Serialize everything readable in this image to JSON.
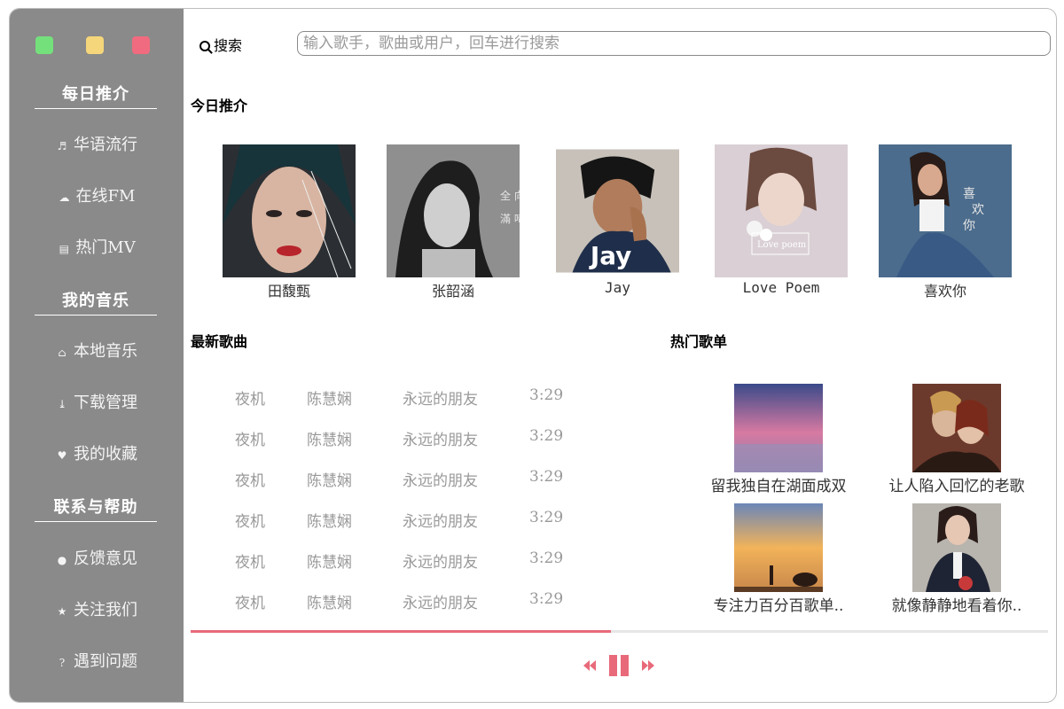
{
  "window_controls": [
    "close",
    "minimize",
    "maximize"
  ],
  "colors": {
    "sidebar": "#8a8a8a",
    "accent": "#e86a7a",
    "muted_text": "#999999"
  },
  "sidebar": {
    "sections": [
      {
        "title": "每日推介",
        "items": [
          {
            "icon": "music-note-icon",
            "label": "华语流行"
          },
          {
            "icon": "cloud-icon",
            "label": "在线FM"
          },
          {
            "icon": "film-icon",
            "label": "热门MV"
          }
        ]
      },
      {
        "title": "我的音乐",
        "items": [
          {
            "icon": "home-icon",
            "label": "本地音乐"
          },
          {
            "icon": "download-icon",
            "label": "下载管理"
          },
          {
            "icon": "heart-icon",
            "label": "我的收藏"
          }
        ]
      },
      {
        "title": "联系与帮助",
        "items": [
          {
            "icon": "comment-icon",
            "label": "反馈意见"
          },
          {
            "icon": "star-icon",
            "label": "关注我们"
          },
          {
            "icon": "question-icon",
            "label": "遇到问题"
          }
        ]
      }
    ]
  },
  "search": {
    "label": "搜索",
    "placeholder": "输入歌手，歌曲或用户，回车进行搜索",
    "value": ""
  },
  "today": {
    "title": "今日推介",
    "albums": [
      {
        "name": "田馥甄"
      },
      {
        "name": "张韶涵"
      },
      {
        "name": "Jay"
      },
      {
        "name": "Love Poem"
      },
      {
        "name": "喜欢你"
      }
    ]
  },
  "newest": {
    "title": "最新歌曲",
    "songs": [
      {
        "title": "夜机",
        "artist": "陈慧娴",
        "album": "永远的朋友",
        "duration": "3:29"
      },
      {
        "title": "夜机",
        "artist": "陈慧娴",
        "album": "永远的朋友",
        "duration": "3:29"
      },
      {
        "title": "夜机",
        "artist": "陈慧娴",
        "album": "永远的朋友",
        "duration": "3:29"
      },
      {
        "title": "夜机",
        "artist": "陈慧娴",
        "album": "永远的朋友",
        "duration": "3:29"
      },
      {
        "title": "夜机",
        "artist": "陈慧娴",
        "album": "永远的朋友",
        "duration": "3:29"
      },
      {
        "title": "夜机",
        "artist": "陈慧娴",
        "album": "永远的朋友",
        "duration": "3:29"
      }
    ]
  },
  "hot": {
    "title": "热门歌单",
    "playlists": [
      {
        "name": "留我独自在湖面成双"
      },
      {
        "name": "让人陷入回忆的老歌"
      },
      {
        "name": "专注力百分百歌单.."
      },
      {
        "name": "就像静静地看着你.."
      }
    ]
  },
  "player": {
    "progress": 0.49,
    "controls": [
      "backward-icon",
      "pause-icon",
      "forward-icon"
    ]
  }
}
